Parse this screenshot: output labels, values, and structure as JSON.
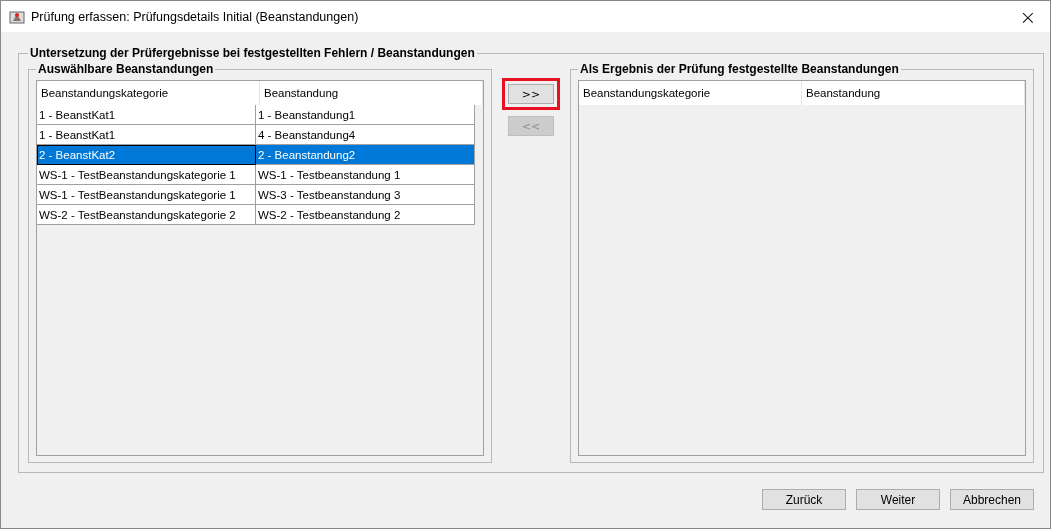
{
  "window": {
    "title": "Prüfung erfassen: Prüfungsdetails Initial (Beanstandungen)",
    "close": "×"
  },
  "group": {
    "title": "Untersetzung der Prüfergebnisse bei festgestellten Fehlern / Beanstandungen"
  },
  "available": {
    "title": "Auswählbare Beanstandungen",
    "columns": [
      "Beanstandungskategorie",
      "Beanstandung"
    ],
    "rows": [
      {
        "cells": [
          "1 - BeanstKat1",
          "1 - Beanstandung1"
        ],
        "selected": false
      },
      {
        "cells": [
          "1 - BeanstKat1",
          "4 - Beanstandung4"
        ],
        "selected": false
      },
      {
        "cells": [
          "2 - BeanstKat2",
          "2 - Beanstandung2"
        ],
        "selected": true
      },
      {
        "cells": [
          "WS-1 - TestBeanstandungskategorie 1",
          "WS-1 - Testbeanstandung 1"
        ],
        "selected": false
      },
      {
        "cells": [
          "WS-1 - TestBeanstandungskategorie 1",
          "WS-3 - Testbeanstandung 3"
        ],
        "selected": false
      },
      {
        "cells": [
          "WS-2 - TestBeanstandungskategorie 2",
          "WS-2 - Testbeanstandung 2"
        ],
        "selected": false
      }
    ]
  },
  "move_buttons": [
    {
      "label": ">>",
      "disabled": false,
      "highlighted": true
    },
    {
      "label": "<<",
      "disabled": true,
      "highlighted": false
    }
  ],
  "result": {
    "title": "Als Ergebnis der Prüfung festgestellte Beanstandungen",
    "columns": [
      "Beanstandungskategorie",
      "Beanstandung"
    ]
  },
  "buttons": [
    "Zurück",
    "Weiter",
    "Abbrechen"
  ]
}
